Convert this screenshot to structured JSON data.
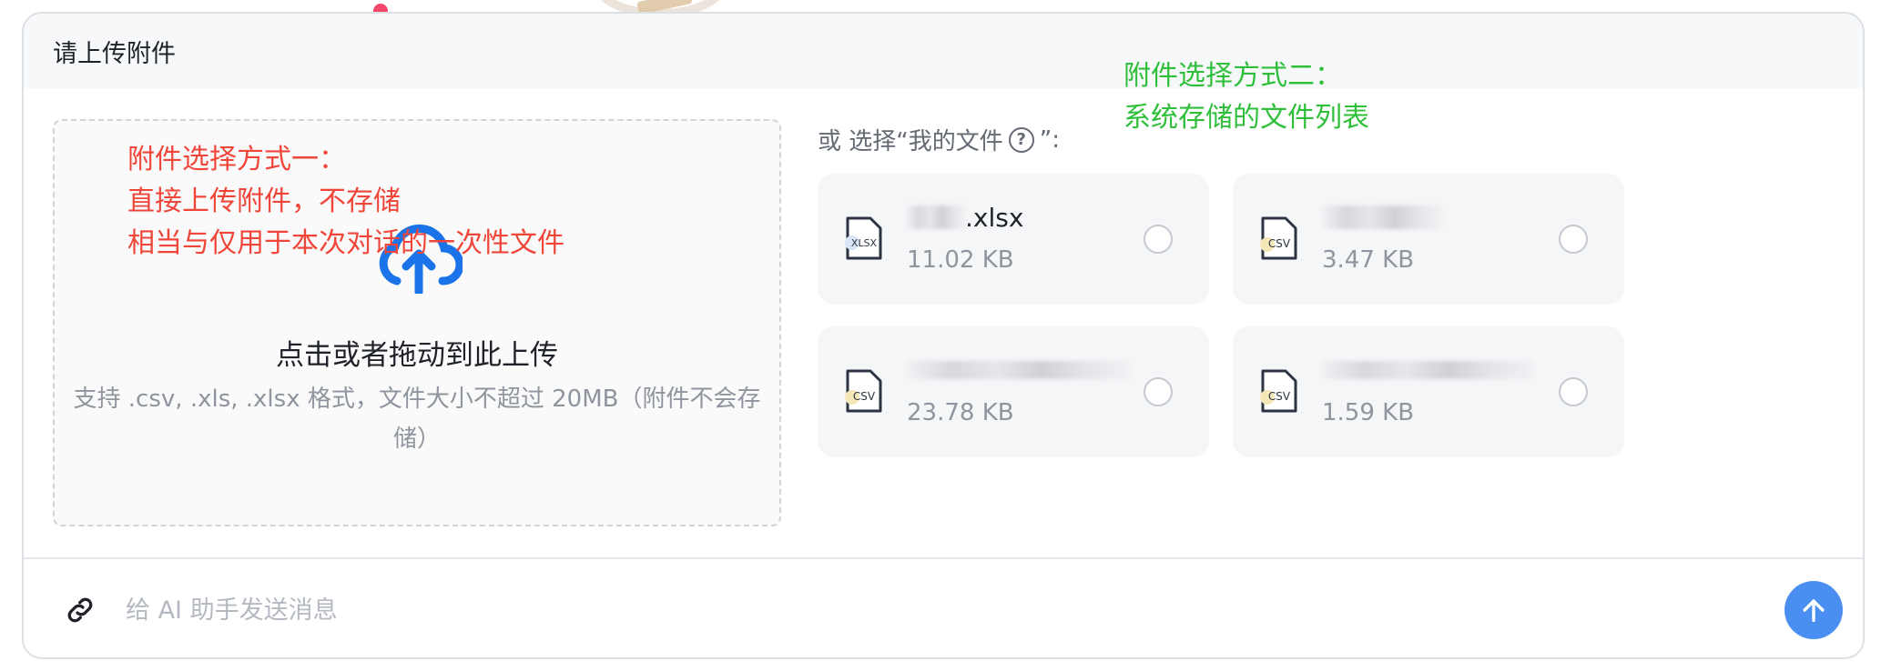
{
  "card": {
    "title": "请上传附件"
  },
  "annotations": {
    "method_one": [
      "附件选择方式一：",
      "直接上传附件，不存储",
      "相当与仅用于本次对话的一次性文件"
    ],
    "method_two": [
      "附件选择方式二：",
      "系统存储的文件列表"
    ]
  },
  "upload": {
    "title": "点击或者拖动到此上传",
    "description": "支持 .csv,  .xls, .xlsx 格式，文件大小不超过 20MB（附件不会存储）"
  },
  "my_files": {
    "label_prefix": "或 选择“我的文件",
    "label_suffix": "”:",
    "help_symbol": "?",
    "files": [
      {
        "icon": "xlsx-file-icon",
        "type_label": "XLSX",
        "name_suffix": ".xlsx",
        "size": "11.02 KB"
      },
      {
        "icon": "csv-file-icon",
        "type_label": "CSV",
        "name_suffix": "",
        "size": "3.47 KB"
      },
      {
        "icon": "csv-file-icon",
        "type_label": "CSV",
        "name_suffix": "",
        "size": "23.78 KB"
      },
      {
        "icon": "csv-file-icon",
        "type_label": "CSV",
        "name_suffix": "",
        "size": "1.59 KB"
      }
    ]
  },
  "composer": {
    "placeholder": "给 AI 助手发送消息"
  },
  "colors": {
    "accent": "#4b8ef1",
    "annotation_red": "#f0463a",
    "annotation_green": "#2fbf3a",
    "upload_icon": "#1a73e8"
  }
}
